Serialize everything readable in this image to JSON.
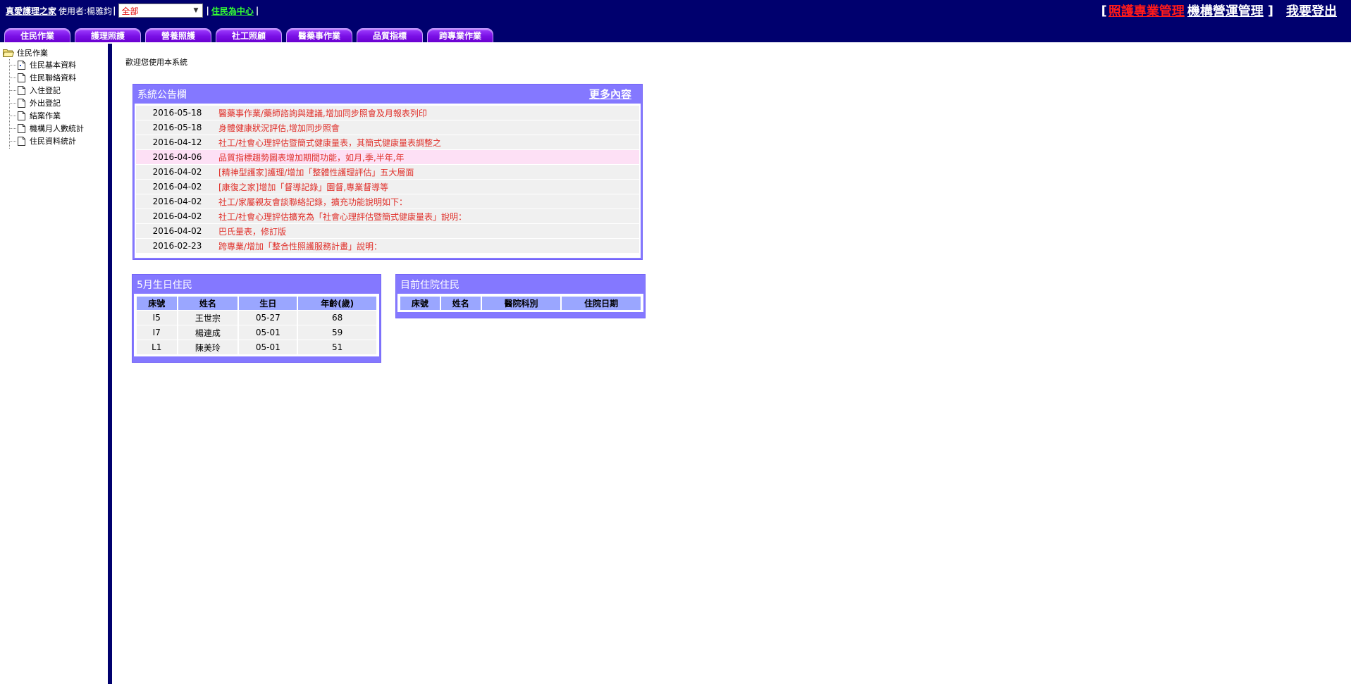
{
  "header": {
    "home_link": "真愛護理之家",
    "user_label": "使用者:楊雅鈞",
    "separator_1": "|",
    "org_select": {
      "selected": "全部"
    },
    "separator_2": "|",
    "resident_center_link": "住民為中心",
    "separator_3": "|",
    "right_open_bracket": "[",
    "care_mgmt_link": "照護專業管理",
    "ops_mgmt_link": "機構營運管理",
    "right_close_bracket": "]",
    "logout_link": "我要登出"
  },
  "tabs": [
    {
      "label": "住民作業"
    },
    {
      "label": "護理照護"
    },
    {
      "label": "營養照護"
    },
    {
      "label": "社工照顧"
    },
    {
      "label": "醫藥事作業"
    },
    {
      "label": "品質指標"
    },
    {
      "label": "跨專業作業"
    }
  ],
  "sidebar": {
    "root": "住民作業",
    "items": [
      {
        "label": "住民基本資料"
      },
      {
        "label": "住民聯絡資料"
      },
      {
        "label": "入住登記"
      },
      {
        "label": "外出登記"
      },
      {
        "label": "結案作業"
      },
      {
        "label": "機構月人數統計"
      },
      {
        "label": "住民資料統計"
      }
    ]
  },
  "main": {
    "welcome": "歡迎您使用本系統",
    "announcements": {
      "title": "系統公告欄",
      "more_link": "更多內容",
      "rows": [
        {
          "date": "2016-05-18",
          "title": "醫藥事作業/藥師諮詢與建議,增加同步照會及月報表列印"
        },
        {
          "date": "2016-05-18",
          "title": "身體健康狀況評估,增加同步照會"
        },
        {
          "date": "2016-04-12",
          "title": "社工/社會心理評估暨簡式健康量表，其簡式健康量表調整之"
        },
        {
          "date": "2016-04-06",
          "title": "品質指標趨勢圖表增加期間功能，如月,季,半年,年"
        },
        {
          "date": "2016-04-02",
          "title": "[精神型護家]護理/增加「整體性護理評估」五大層面"
        },
        {
          "date": "2016-04-02",
          "title": "[康復之家]增加「督導記錄」園督,專業督導等"
        },
        {
          "date": "2016-04-02",
          "title": "社工/家屬親友會談聯絡記錄，擴充功能說明如下："
        },
        {
          "date": "2016-04-02",
          "title": "社工/社會心理評估擴充為「社會心理評估暨簡式健康量表」說明："
        },
        {
          "date": "2016-04-02",
          "title": "巴氏量表，修訂版"
        },
        {
          "date": "2016-02-23",
          "title": "跨專業/增加「整合性照護服務計畫」說明："
        }
      ]
    },
    "birthday": {
      "title": "5月生日住民",
      "headers": [
        "床號",
        "姓名",
        "生日",
        "年齡(歲)"
      ],
      "rows": [
        [
          "I5",
          "王世宗",
          "05-27",
          "68"
        ],
        [
          "I7",
          "楊連成",
          "05-01",
          "59"
        ],
        [
          "L1",
          "陳美玲",
          "05-01",
          "51"
        ]
      ]
    },
    "current": {
      "title": "目前住院住民",
      "headers": [
        "床號",
        "姓名",
        "醫院科別",
        "住院日期"
      ]
    }
  },
  "colors": {
    "topbar": "#00006e",
    "tab": "#7a10e6",
    "panel": "#8478ff",
    "table_header": "#9aa6ff",
    "announcement_text": "#e0302a",
    "highlight_row": "#fde0f5"
  }
}
